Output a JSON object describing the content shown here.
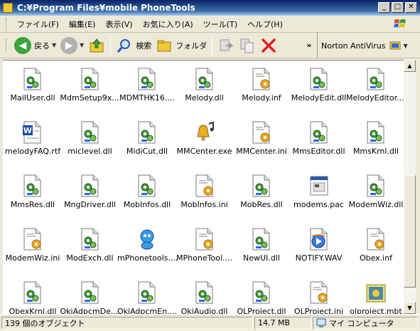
{
  "window": {
    "title": "C:¥Program Files¥mobile PhoneTools"
  },
  "menu": [
    "ファイル(F)",
    "編集(E)",
    "表示(V)",
    "お気に入り(A)",
    "ツール(T)",
    "ヘルプ(H)"
  ],
  "toolbar": {
    "back_label": "戻る",
    "search_label": "検索",
    "folder_label": "フォルダ",
    "norton_label": "Norton AntiVirus"
  },
  "files": [
    {
      "name": "MailUser.dll",
      "type": "dll"
    },
    {
      "name": "MdmSetup9x....",
      "type": "dll"
    },
    {
      "name": "MDMTHK16....",
      "type": "dll"
    },
    {
      "name": "Melody.dll",
      "type": "dll"
    },
    {
      "name": "Melody.inf",
      "type": "inf"
    },
    {
      "name": "MelodyEdit.dll",
      "type": "dll"
    },
    {
      "name": "MelodyEditor....",
      "type": "dll"
    },
    {
      "name": "melodyFAQ.rtf",
      "type": "rtf"
    },
    {
      "name": "miclevel.dll",
      "type": "dll"
    },
    {
      "name": "MidiCut.dll",
      "type": "dll"
    },
    {
      "name": "MMCenter.exe",
      "type": "exe"
    },
    {
      "name": "MMCenter.ini",
      "type": "ini"
    },
    {
      "name": "MmsEditor.dll",
      "type": "dll"
    },
    {
      "name": "MmsKrnl.dll",
      "type": "dll"
    },
    {
      "name": "MmsRes.dll",
      "type": "dll"
    },
    {
      "name": "MngDriver.dll",
      "type": "dll"
    },
    {
      "name": "MobInfos.dll",
      "type": "dll"
    },
    {
      "name": "MobInfos.ini",
      "type": "ini"
    },
    {
      "name": "MobRes.dll",
      "type": "dll"
    },
    {
      "name": "modems.pac",
      "type": "pac"
    },
    {
      "name": "ModemWiz.dll",
      "type": "dll"
    },
    {
      "name": "ModemWiz.ini",
      "type": "ini"
    },
    {
      "name": "ModExch.dll",
      "type": "dll"
    },
    {
      "name": "mPhonetools....",
      "type": "mascot"
    },
    {
      "name": "MPhoneTool....",
      "type": "ini"
    },
    {
      "name": "NewUI.dll",
      "type": "dll"
    },
    {
      "name": "NOTIFY.WAV",
      "type": "wav"
    },
    {
      "name": "Obex.inf",
      "type": "inf"
    },
    {
      "name": "ObexKrnl.dll",
      "type": "dll"
    },
    {
      "name": "OkiAdpcmDe....",
      "type": "dll"
    },
    {
      "name": "OkiAdpcmEn....",
      "type": "dll"
    },
    {
      "name": "OkiAudio.dll",
      "type": "dll"
    },
    {
      "name": "OLProject.dll",
      "type": "dll"
    },
    {
      "name": "OLProject.ini",
      "type": "ini"
    },
    {
      "name": "olproject.mbt",
      "type": "mbt"
    }
  ],
  "status": {
    "count": "139 個のオブジェクト",
    "size": "14.7 MB",
    "location": "マイ コンピュータ"
  },
  "colors": {
    "title_bar": "#0a246a",
    "dll_gear": "#4a9a3a",
    "back_button": "#3aa33a"
  }
}
